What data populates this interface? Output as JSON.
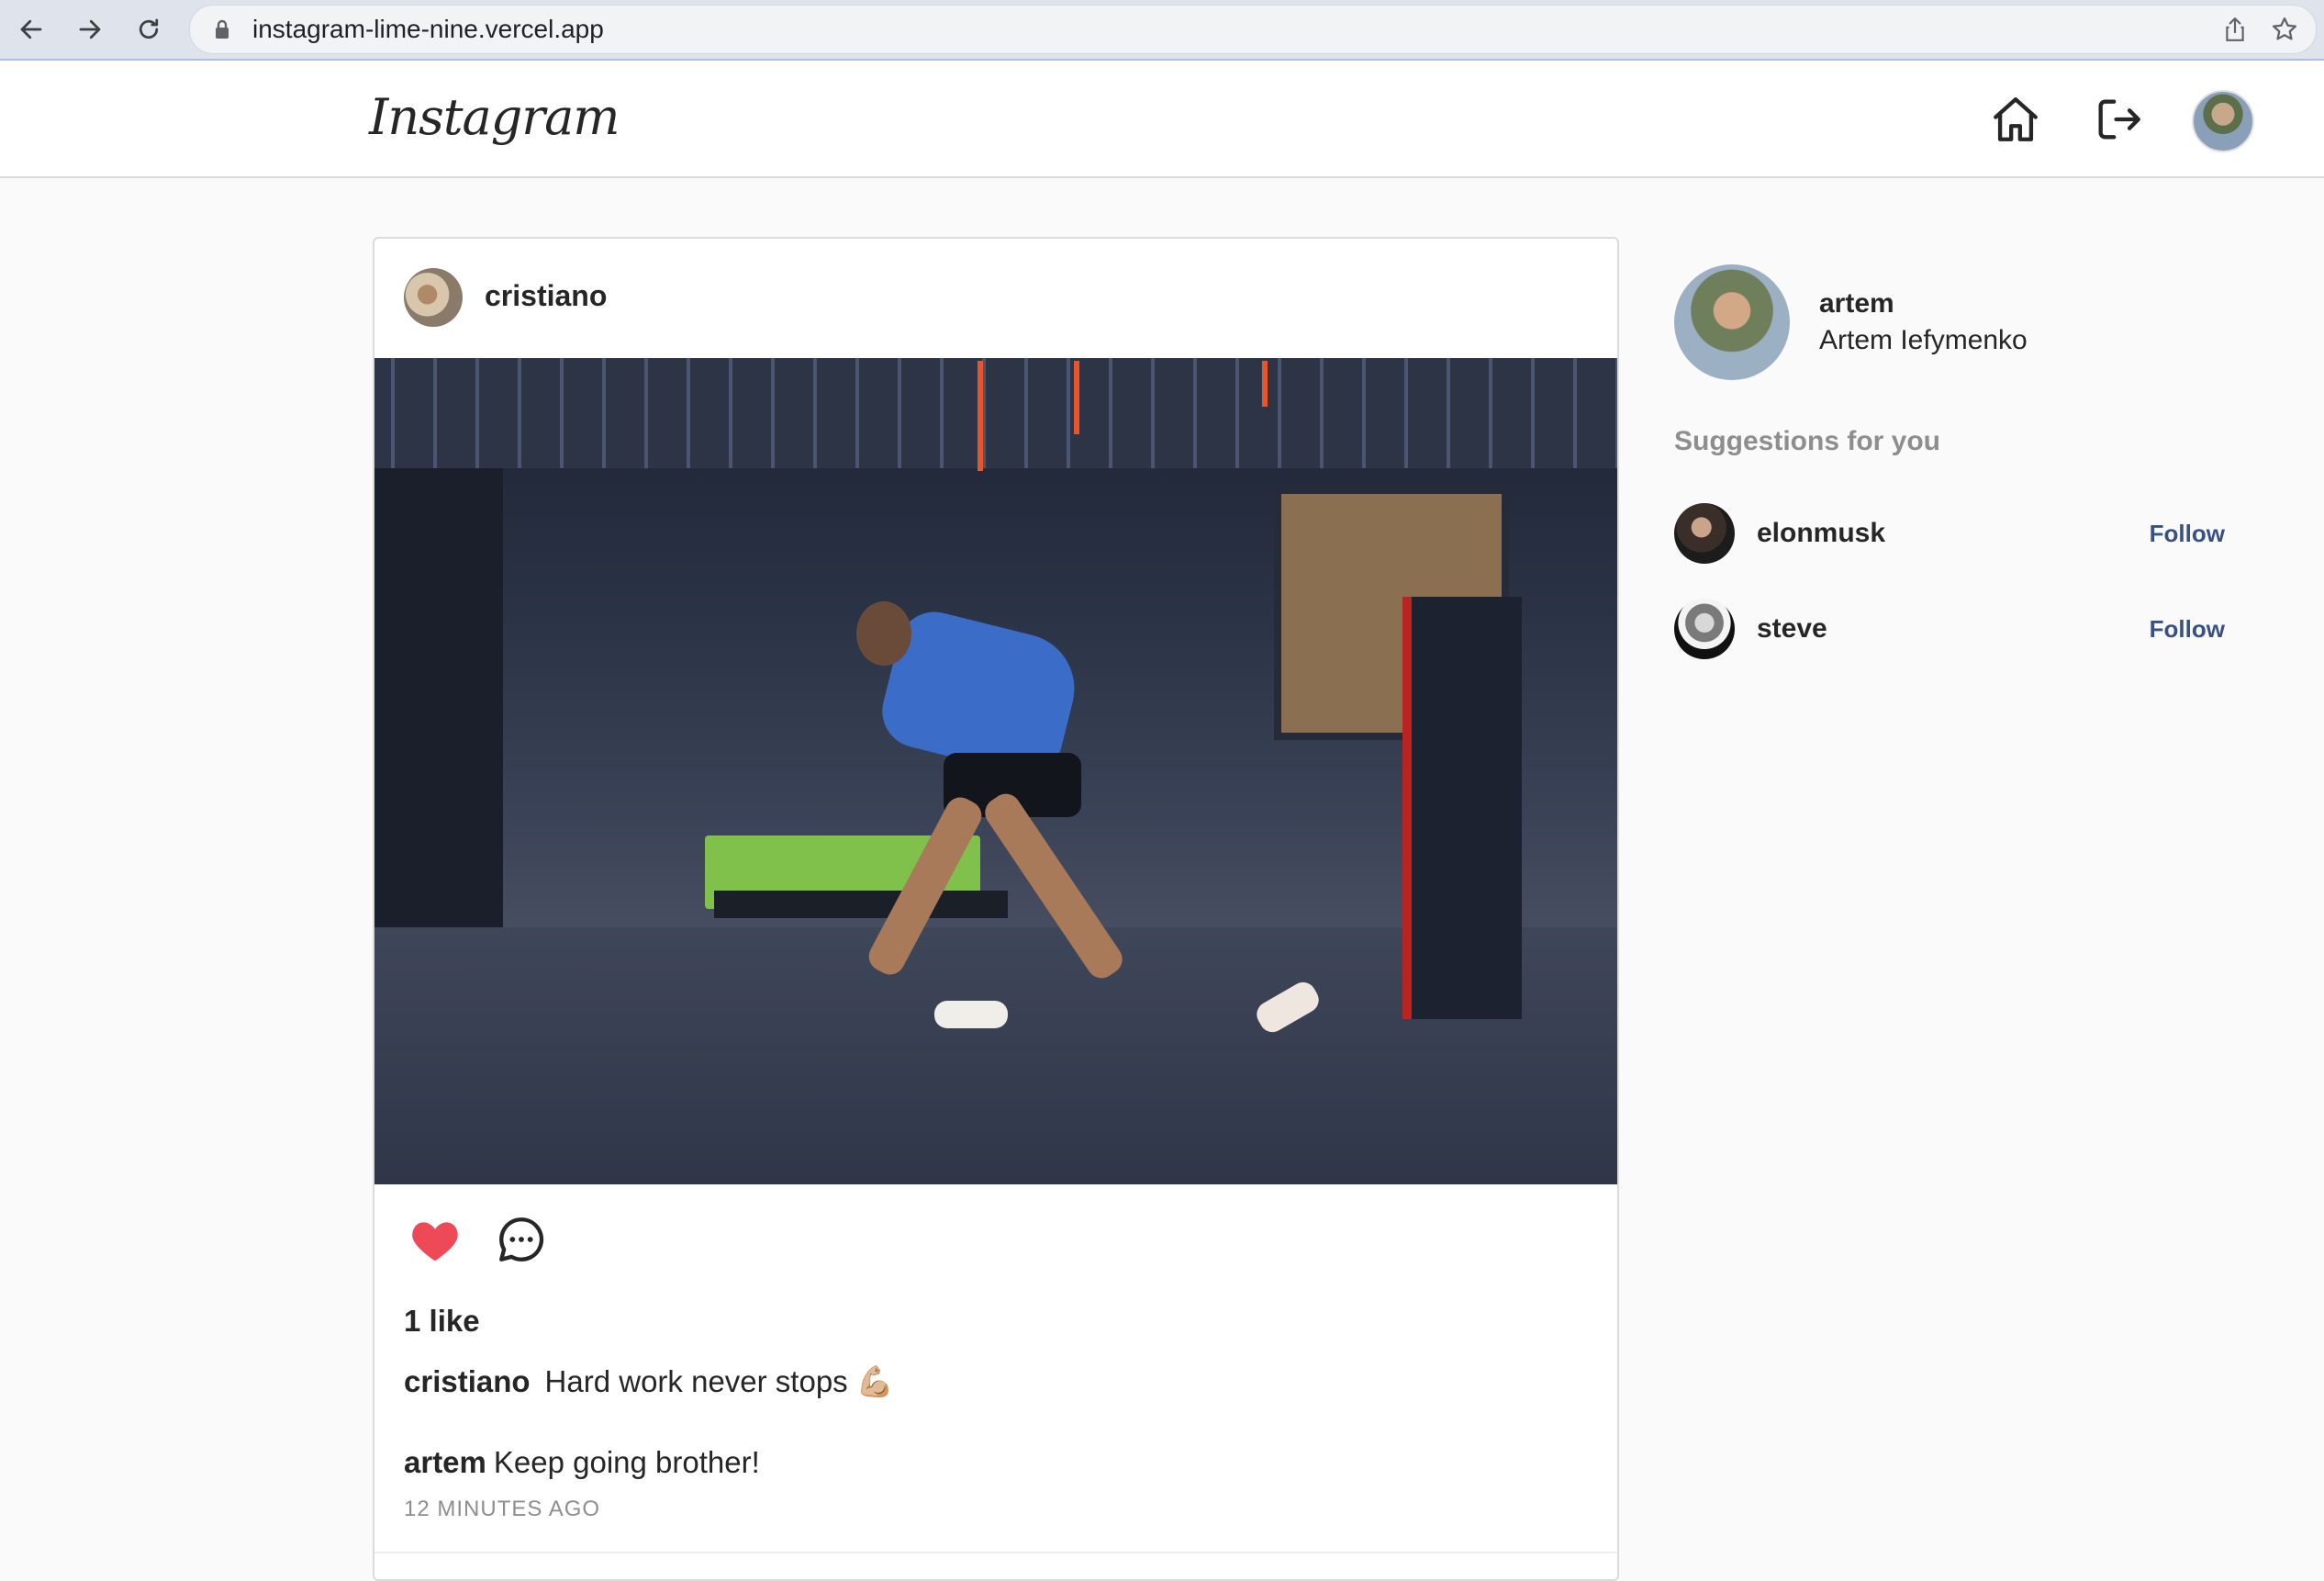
{
  "browser": {
    "url": "instagram-lime-nine.vercel.app"
  },
  "header": {
    "logo_text": "Instagram",
    "icons": [
      "home-icon",
      "logout-icon"
    ]
  },
  "post": {
    "username": "cristiano",
    "likes_text": "1 like",
    "caption_user": "cristiano",
    "caption_text": "Hard work never stops 💪🏼",
    "comments": [
      {
        "user": "artem",
        "text": "Keep going brother!"
      }
    ],
    "time_ago": "12 minutes ago",
    "liked": true
  },
  "sidebar": {
    "username": "artem",
    "full_name": "Artem Iefymenko",
    "suggestions_title": "Suggestions for you",
    "suggestions": [
      {
        "username": "elonmusk",
        "action": "Follow"
      },
      {
        "username": "steve",
        "action": "Follow"
      }
    ]
  },
  "colors": {
    "like_red": "#ed4956",
    "follow_blue": "#385185",
    "muted_text": "#8e8e8e"
  }
}
